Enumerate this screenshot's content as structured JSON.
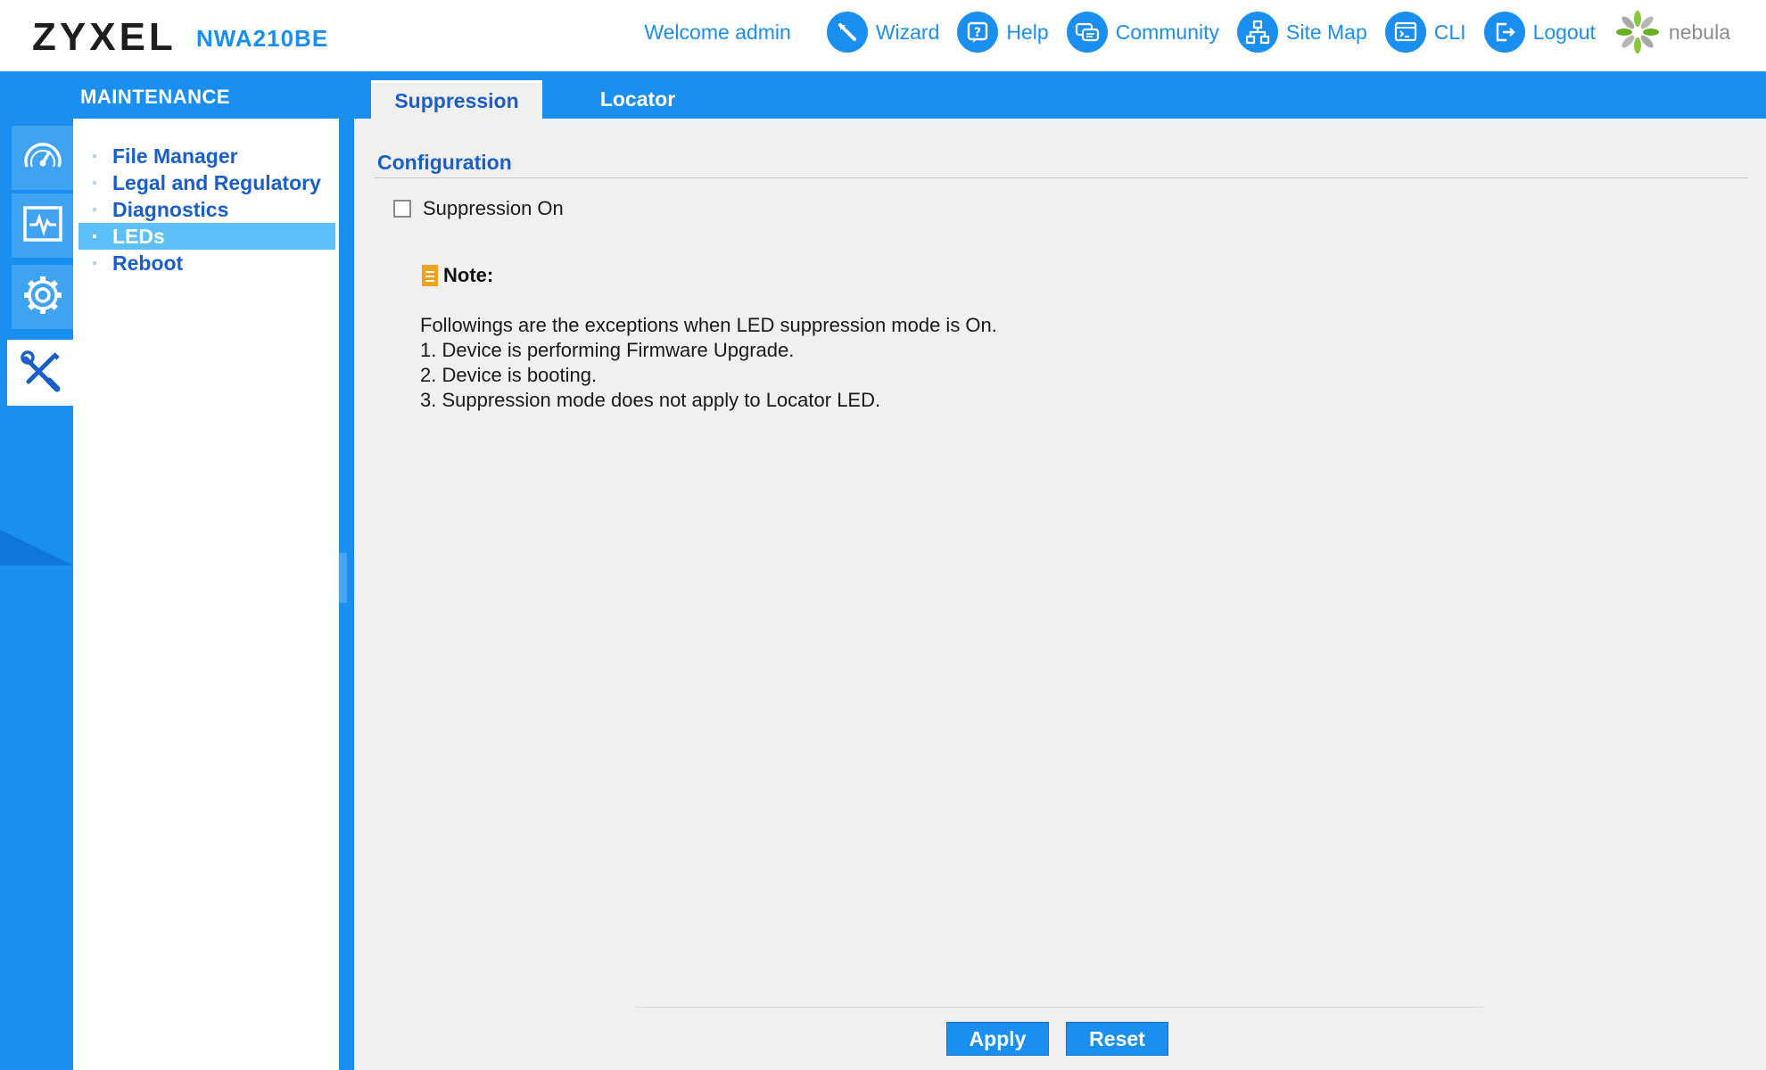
{
  "header": {
    "brand": "ZYXEL",
    "model": "NWA210BE",
    "welcome": "Welcome admin",
    "nav": [
      {
        "label": "Wizard",
        "icon": "wizard-icon"
      },
      {
        "label": "Help",
        "icon": "help-icon"
      },
      {
        "label": "Community",
        "icon": "community-icon"
      },
      {
        "label": "Site Map",
        "icon": "site-map-icon"
      },
      {
        "label": "CLI",
        "icon": "cli-icon"
      },
      {
        "label": "Logout",
        "icon": "logout-icon"
      },
      {
        "label": "nebula",
        "icon": "nebula-icon"
      }
    ]
  },
  "section": {
    "title": "MAINTENANCE"
  },
  "tabs": [
    {
      "label": "Suppression",
      "active": true
    },
    {
      "label": "Locator",
      "active": false
    }
  ],
  "rail": [
    {
      "icon": "dashboard-icon",
      "active": false
    },
    {
      "icon": "monitor-icon",
      "active": false
    },
    {
      "icon": "configuration-icon",
      "active": false
    },
    {
      "icon": "maintenance-icon",
      "active": true
    }
  ],
  "submenu": [
    {
      "label": "File Manager",
      "active": false
    },
    {
      "label": "Legal and Regulatory",
      "active": false
    },
    {
      "label": "Diagnostics",
      "active": false
    },
    {
      "label": "LEDs",
      "active": true
    },
    {
      "label": "Reboot",
      "active": false
    }
  ],
  "config": {
    "title": "Configuration",
    "suppression_label": "Suppression On",
    "suppression_checked": false
  },
  "note": {
    "label": "Note:",
    "lines": [
      "Followings are the exceptions when LED suppression mode is On.",
      "1. Device is performing Firmware Upgrade.",
      "2. Device is booting.",
      "3. Suppression mode does not apply to Locator LED."
    ]
  },
  "buttons": {
    "apply": "Apply",
    "reset": "Reset"
  },
  "colors": {
    "accent": "#1a8ff0",
    "link": "#1a5fc8",
    "active_menu": "#5ec0f9",
    "note_icon": "#f0a21b"
  }
}
